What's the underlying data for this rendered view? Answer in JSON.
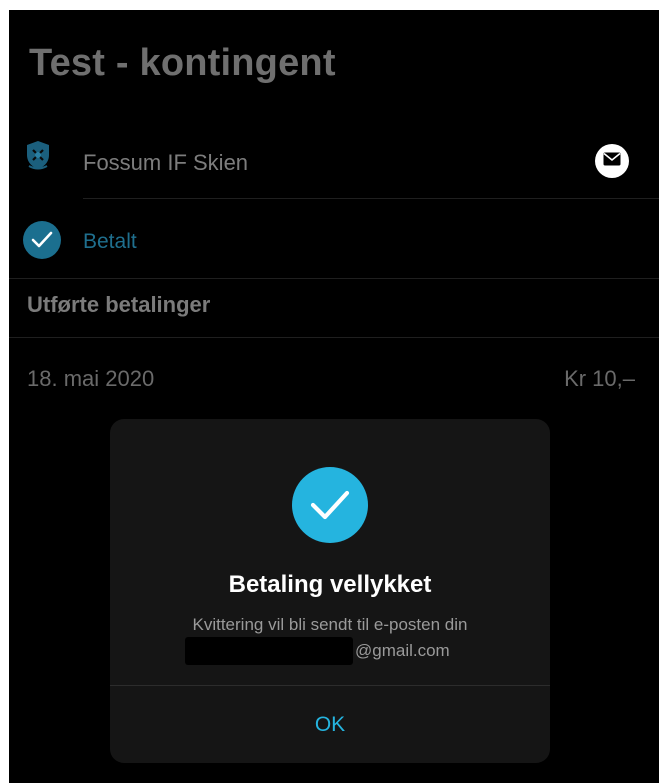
{
  "page": {
    "title": "Test - kontingent"
  },
  "organization": {
    "name": "Fossum IF Skien",
    "logo_icon": "club-crest-icon",
    "contact_icon": "mail-icon"
  },
  "status": {
    "label": "Betalt",
    "icon": "check-circle-icon",
    "color": "#1f6f8e"
  },
  "payments": {
    "section_title": "Utførte betalinger",
    "items": [
      {
        "date": "18. mai 2020",
        "amount": "Kr 10,–"
      }
    ]
  },
  "dialog": {
    "icon": "check-circle-icon",
    "title": "Betaling vellykket",
    "message": "Kvittering vil bli sendt til e-posten din",
    "email_domain": "@gmail.com",
    "ok_label": "OK",
    "accent_color": "#25b4df"
  }
}
